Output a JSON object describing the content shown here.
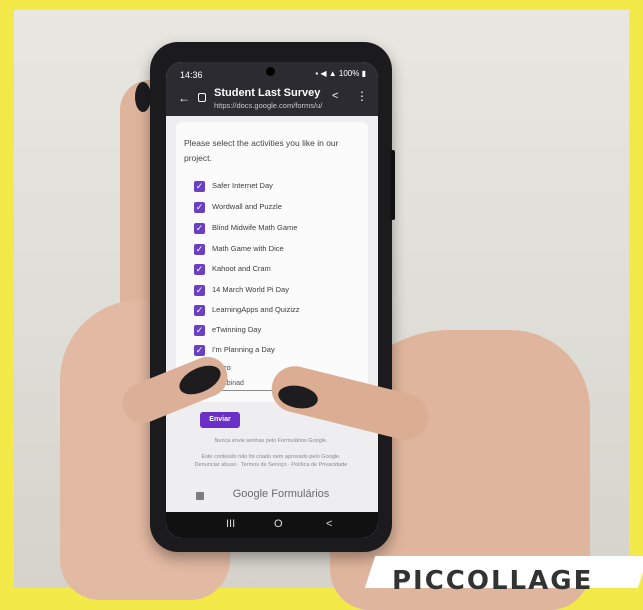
{
  "status_bar": {
    "time": "14:36",
    "battery": "100%"
  },
  "browser": {
    "title": "Student Last Survey",
    "url": "https://docs.google.com/forms/u/"
  },
  "form": {
    "question": "Please select the activities you like in our project.",
    "options": [
      {
        "label": "Safer Internet Day",
        "checked": true
      },
      {
        "label": "Wordwall and Puzzle",
        "checked": true
      },
      {
        "label": "Blind Midwife Math Game",
        "checked": true
      },
      {
        "label": "Math Game with Dice",
        "checked": true
      },
      {
        "label": "Kahoot and Cram",
        "checked": true
      },
      {
        "label": "14 March World Pi Day",
        "checked": true
      },
      {
        "label": "LearningApps and Quizizz",
        "checked": true
      },
      {
        "label": "eTwinning Day",
        "checked": true
      },
      {
        "label": "I'm Planning a Day",
        "checked": true
      },
      {
        "label": "Outro",
        "checked": true
      }
    ],
    "other_value": "Combinad",
    "submit_label": "Enviar",
    "footer_notice": "Nunca envie senhas pelo Formulários Google.",
    "footer_terms_1": "Este conteúdo não foi criado nem aprovado pelo Google.",
    "footer_terms_2": "Denunciar abuso · Termos de Serviço · Política de Privacidade",
    "brand": "Google Formulários"
  },
  "nav": {
    "recents": "III",
    "home": "O",
    "back": "<"
  },
  "watermark": "PICCOLLAGE",
  "colors": {
    "accent": "#6a3fc1",
    "frame": "#f3ea4a"
  }
}
